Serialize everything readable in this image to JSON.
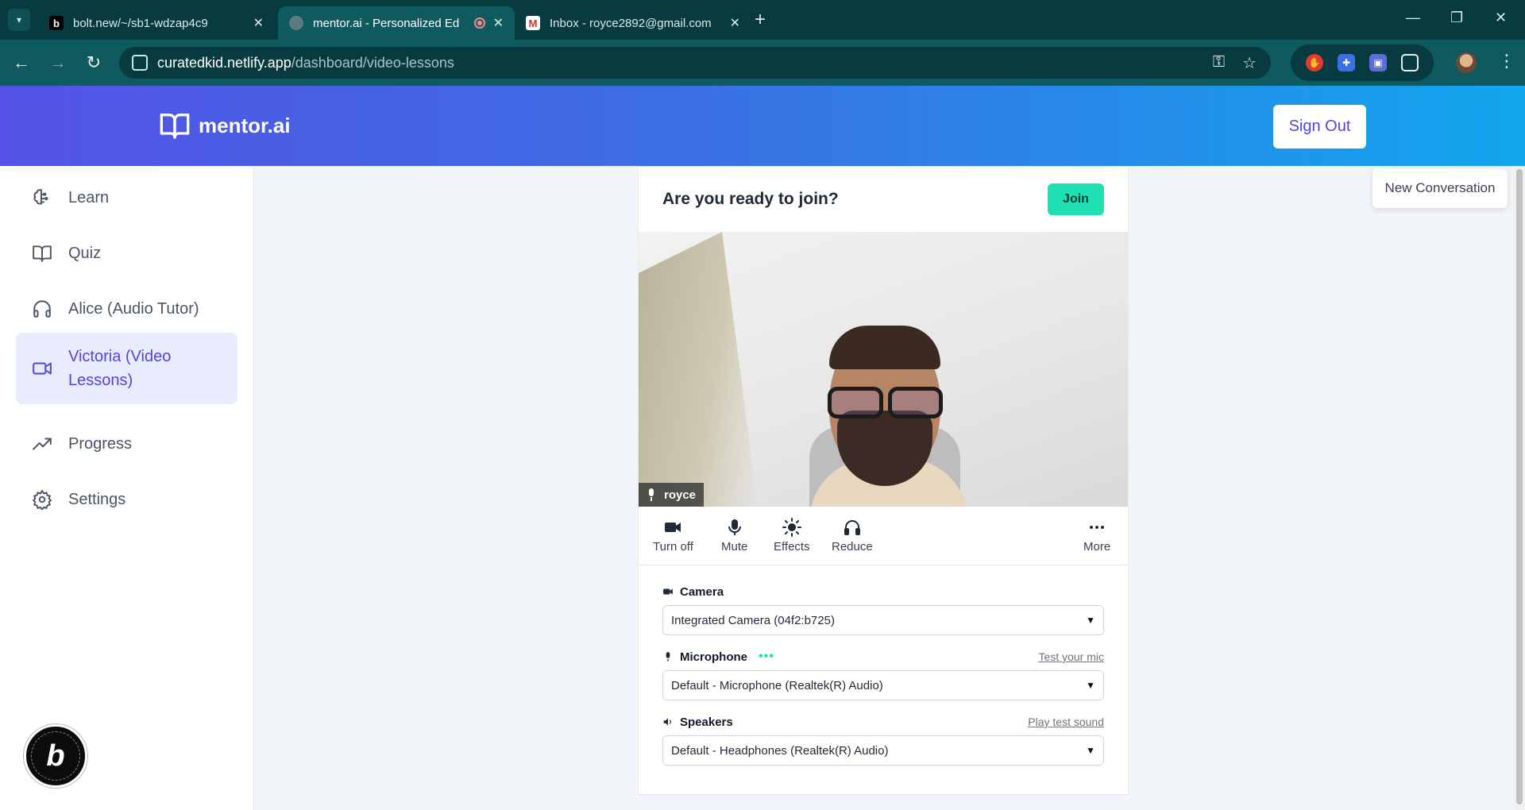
{
  "browser": {
    "tabs": [
      {
        "title": "bolt.new/~/sb1-wdzap4c9",
        "favicon": "b"
      },
      {
        "title": "mentor.ai - Personalized Ed",
        "favicon": "globe"
      },
      {
        "title": "Inbox - royce2892@gmail.com",
        "favicon": "gmail"
      }
    ],
    "url_host": "curatedkid.netlify.app",
    "url_path": "/dashboard/video-lessons"
  },
  "header": {
    "logo_text": "mentor.ai",
    "sign_out": "Sign Out"
  },
  "sidebar": {
    "items": [
      {
        "label": "Learn",
        "icon": "brain-icon"
      },
      {
        "label": "Quiz",
        "icon": "book-icon"
      },
      {
        "label": "Alice (Audio Tutor)",
        "icon": "headphones-icon"
      },
      {
        "label": "Victoria (Video Lessons)",
        "icon": "video-icon",
        "active": true
      },
      {
        "label": "Progress",
        "icon": "trend-icon"
      },
      {
        "label": "Settings",
        "icon": "gear-icon"
      }
    ]
  },
  "prejoin": {
    "heading": "Are you ready to join?",
    "join": "Join",
    "participant": "royce",
    "controls": [
      "Turn off",
      "Mute",
      "Effects",
      "Reduce",
      "More"
    ],
    "camera_label": "Camera",
    "camera_value": "Integrated Camera (04f2:b725)",
    "mic_label": "Microphone",
    "mic_link": "Test your mic",
    "mic_value": "Default - Microphone (Realtek(R) Audio)",
    "speakers_label": "Speakers",
    "speakers_link": "Play test sound",
    "speakers_value": "Default - Headphones (Realtek(R) Audio)"
  },
  "new_conversation": "New Conversation",
  "colors": {
    "accent": "#4f46e5",
    "join": "#1fe0b2",
    "header_start": "#5452e6",
    "header_end": "#12a6ee"
  }
}
